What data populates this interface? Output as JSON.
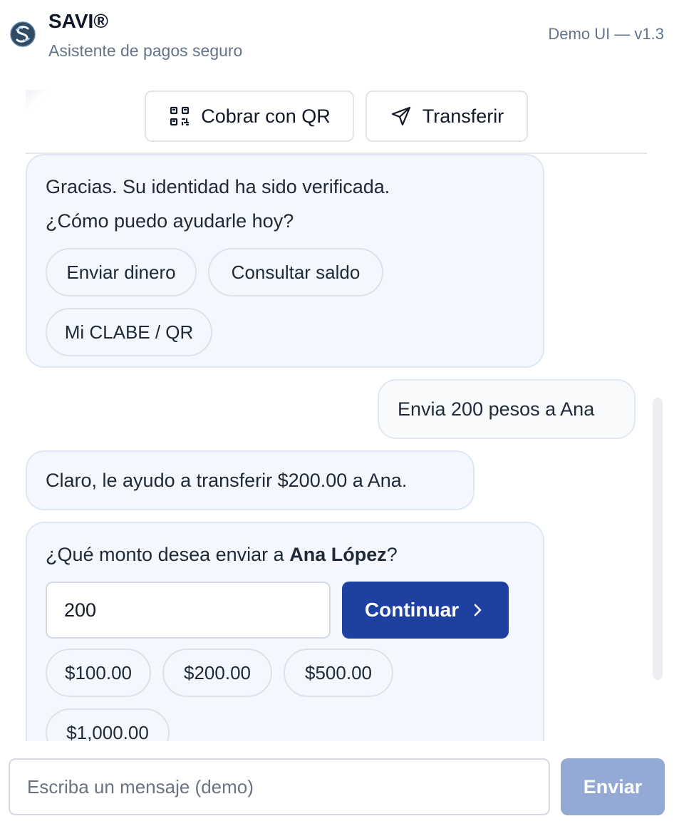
{
  "header": {
    "title": "SAVI®",
    "subtitle": "Asistente de pagos seguro",
    "version": "Demo UI — v1.3",
    "logo_icon": "savi-logo-icon"
  },
  "actions": {
    "qr": {
      "label": "Cobrar con QR",
      "icon": "qr-code-icon"
    },
    "transfer": {
      "label": "Transferir",
      "icon": "send-icon"
    }
  },
  "messages": {
    "welcome": {
      "line1": "Gracias. Su identidad ha sido verificada.",
      "line2": "¿Cómo puedo ayudarle hoy?",
      "options": [
        "Enviar dinero",
        "Consultar saldo",
        "Mi CLABE / QR"
      ]
    },
    "user": {
      "text": "Envia 200 pesos a Ana"
    },
    "reply": {
      "text": "Claro, le ayudo a transferir $200.00 a Ana."
    },
    "amount_prompt": {
      "prefix": "¿Qué monto desea enviar a ",
      "recipient": "Ana López",
      "suffix": "?",
      "amount_value": "200",
      "continue_label": "Continuar",
      "quick_amounts": [
        "$100.00",
        "$200.00",
        "$500.00",
        "$1,000.00"
      ]
    }
  },
  "composer": {
    "placeholder": "Escriba un mensaje (demo)",
    "send_label": "Enviar"
  },
  "colors": {
    "primary": "#1e40a0",
    "send_disabled": "#94a9d4",
    "bot_bubble": "#f4f7fe",
    "muted_text": "#64748b"
  }
}
